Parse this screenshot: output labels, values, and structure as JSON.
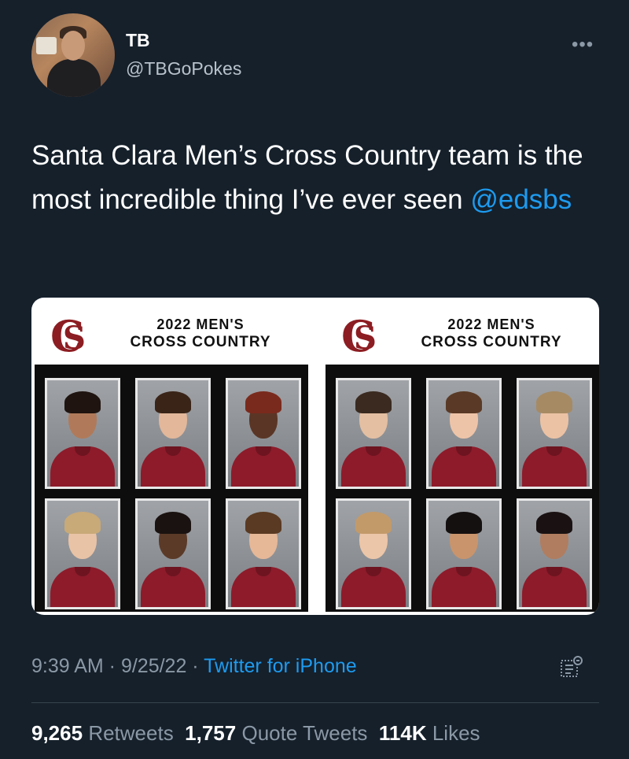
{
  "tweet": {
    "author_name": "TB",
    "author_handle": "@TBGoPokes",
    "text": "Santa Clara Men’s Cross Country team is the most incredible thing I’ve ever seen ",
    "mention": "@edsbs",
    "timestamp": "9:39 AM · 9/25/22 · ",
    "source": "Twitter for iPhone"
  },
  "media": {
    "left_panel": {
      "title_line1": "2022 MEN'S",
      "title_line2": "CROSS COUNTRY"
    },
    "right_panel": {
      "title_line1": "2022 MEN'S",
      "title_line2": "CROSS COUNTRY"
    }
  },
  "stats": {
    "retweets_count": "9,265",
    "retweets_label": "Retweets",
    "quote_count": "1,757",
    "quote_label": "Quote Tweets",
    "likes_count": "114K",
    "likes_label": "Likes"
  },
  "icons": [
    "more-icon",
    "analytics-icon"
  ],
  "colors": {
    "background": "#15202b",
    "link": "#1d9bf0",
    "muted": "#8b98a5",
    "team_maroon": "#8c1d22"
  }
}
